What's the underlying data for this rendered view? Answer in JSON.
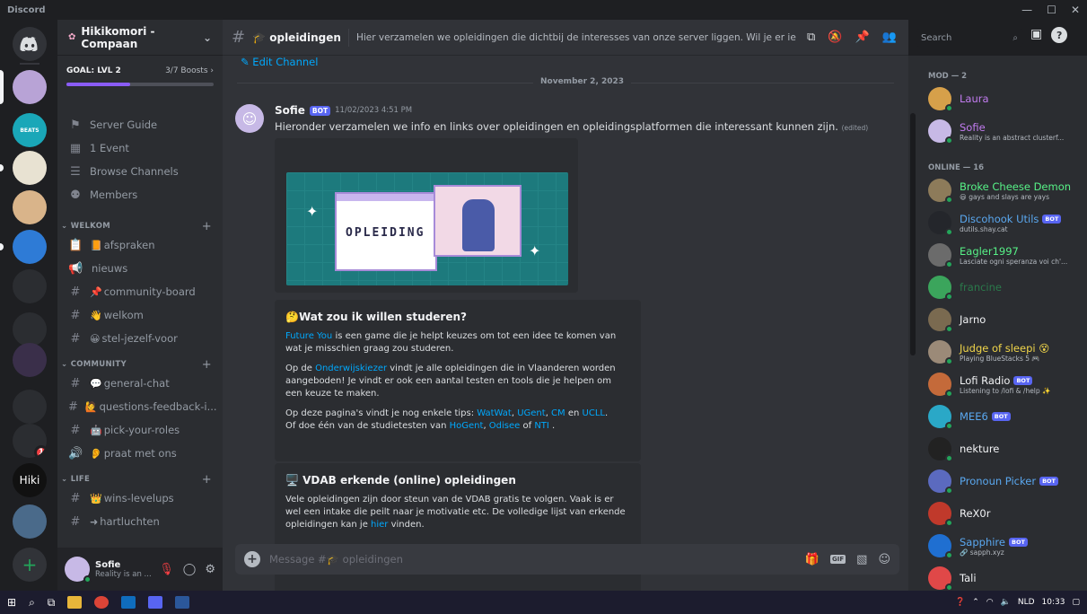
{
  "window": {
    "app_name": "Discord",
    "controls": [
      "—",
      "☐",
      "✕"
    ]
  },
  "rail": {
    "badge": "1",
    "hiki_label": "Hiki",
    "add": "+"
  },
  "guild": {
    "name": "Hikikomori - Compaan",
    "goal_label": "GOAL: LVL 2",
    "boosts": "3/7 Boosts",
    "boost_progress": 0.43
  },
  "channels_top": [
    {
      "icon": "signpost-icon",
      "label": "Server Guide"
    },
    {
      "icon": "calendar-icon",
      "label": "1 Event"
    },
    {
      "icon": "browse-icon",
      "label": "Browse Channels"
    },
    {
      "icon": "members-icon",
      "label": "Members"
    }
  ],
  "categories": {
    "welkom": "WELKOM",
    "community": "COMMUNITY",
    "life": "LIFE"
  },
  "welkom_channels": [
    {
      "icon": "📋",
      "emoji": "📙",
      "label": "afspraken"
    },
    {
      "icon": "📢",
      "emoji": "",
      "label": "nieuws"
    },
    {
      "icon": "#",
      "emoji": "📌",
      "label": "community-board"
    },
    {
      "icon": "#",
      "emoji": "👋",
      "label": "welkom"
    },
    {
      "icon": "#",
      "emoji": "😀",
      "label": "stel-jezelf-voor"
    }
  ],
  "community_channels": [
    {
      "icon": "#",
      "emoji": "💬",
      "label": "general-chat"
    },
    {
      "icon": "#",
      "emoji": "🙋",
      "label": "questions-feedback-i..."
    },
    {
      "icon": "#",
      "emoji": "🤖",
      "label": "pick-your-roles"
    },
    {
      "icon": "🔊",
      "emoji": "👂",
      "label": "praat met ons"
    }
  ],
  "life_channels": [
    {
      "icon": "#",
      "emoji": "👑",
      "label": "wins-levelups"
    },
    {
      "icon": "#",
      "emoji": "➜",
      "label": "hartluchten"
    }
  ],
  "user": {
    "name": "Sofie",
    "status": "Reality is an ..."
  },
  "header": {
    "channel": "opleidingen",
    "topic": "Hier verzamelen we opleidingen die dichtbij de interesses van onze server liggen. Wil je er iets aan toevo...",
    "search_placeholder": "Search"
  },
  "chat": {
    "edit_channel": "Edit Channel",
    "date_divider": "November 2, 2023",
    "author": "Sofie",
    "bot_tag": "BOT",
    "timestamp": "11/02/2023 4:51 PM",
    "text": "Hieronder verzamelen we info en links over opleidingen en opleidingsplatformen die interessant kunnen zijn.",
    "edited": "(edited)",
    "banner_word": "OPLEIDING",
    "embed1": {
      "title": "Wat zou ik willen studeren?",
      "p1_link": "Future You",
      "p1_text": " is een game die je helpt keuzes om tot een idee te komen van wat je misschien graag zou studeren.",
      "p2_pre": "Op de ",
      "p2_link": "Onderwijskiezer",
      "p2_text": " vindt je alle opleidingen die in Vlaanderen worden aangeboden! Je vindt er ook een aantal testen en tools die je helpen om een keuze te maken.",
      "p3_pre": "Op deze pagina's vindt je nog enkele tips: ",
      "p3_l1": "WatWat",
      "p3_l2": "UGent",
      "p3_l3": "CM",
      "p3_en": " en ",
      "p3_l4": "UCLL",
      "p3_line2": "Of doe één van de studietesten van ",
      "p3_l5": "HoGent",
      "p3_l6": "Odisee",
      "p3_of": " of ",
      "p3_l7": "NTI"
    },
    "embed2": {
      "title": "VDAB erkende (online) opleidingen",
      "p1": "Vele opleidingen zijn door steun van de VDAB gratis te volgen. Vaak is er wel een intake die peilt naar je motivatie etc. De volledige lijst van erkende opleidingen kan je ",
      "p1_link": "hier",
      "p1_end": " vinden."
    },
    "composer_placeholder": "Message #🎓 opleidingen"
  },
  "members": {
    "group_mod": "MOD — 2",
    "group_online": "ONLINE — 16",
    "mods": [
      {
        "name": "Laura",
        "status": "",
        "color": "#c27cf0",
        "avatar": "#d6a04a"
      },
      {
        "name": "Sofie",
        "status": "Reality is an abstract clusterf...",
        "color": "#c27cf0",
        "avatar": "#c7b9e6"
      }
    ],
    "online": [
      {
        "name": "Broke Cheese Demon",
        "status": "😃 gays and slays are yays",
        "color": "#57f287",
        "avatar": "#8d7b5a",
        "bot": false
      },
      {
        "name": "Discohook Utils",
        "status": "dutils.shay.cat",
        "color": "#5aa8f0",
        "avatar": "#24262b",
        "bot": true
      },
      {
        "name": "Eagler1997",
        "status": "Lasciate ogni speranza voi ch'...",
        "color": "#57f287",
        "avatar": "#6b6b6b",
        "bot": false
      },
      {
        "name": "francine",
        "status": "",
        "color": "#2b7a4b",
        "avatar": "#3ba55c",
        "bot": false
      },
      {
        "name": "Jarno",
        "status": "",
        "color": "#f2f3f5",
        "avatar": "#7a6a50",
        "bot": false
      },
      {
        "name": "Judge of sleepi 😵",
        "status": "Playing BlueStacks 5 🎮",
        "color": "#f0d54a",
        "avatar": "#9b8a78",
        "bot": false
      },
      {
        "name": "Lofi Radio",
        "status": "Listening to /lofi & /help ✨",
        "color": "#f2f3f5",
        "avatar": "#c46a3a",
        "bot": true
      },
      {
        "name": "MEE6",
        "status": "",
        "color": "#5aa8f0",
        "avatar": "#2aa8c7",
        "bot": true
      },
      {
        "name": "nekture",
        "status": "",
        "color": "#f2f3f5",
        "avatar": "#222222",
        "bot": false
      },
      {
        "name": "Pronoun Picker",
        "status": "",
        "color": "#5aa8f0",
        "avatar": "#5b6abf",
        "bot": true
      },
      {
        "name": "ReX0r",
        "status": "",
        "color": "#f2f3f5",
        "avatar": "#c0392b",
        "bot": false
      },
      {
        "name": "Sapphire",
        "status": "🔗 sapph.xyz",
        "color": "#5aa8f0",
        "avatar": "#1f6fd1",
        "bot": true
      },
      {
        "name": "Tali",
        "status": "",
        "color": "#f2f3f5",
        "avatar": "#e04848",
        "bot": false
      }
    ]
  },
  "taskbar": {
    "lang": "NLD",
    "time": "10:33"
  }
}
